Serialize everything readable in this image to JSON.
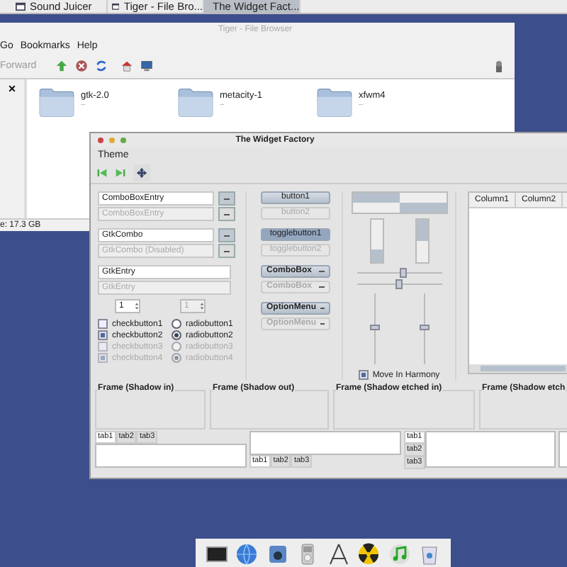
{
  "taskbar": {
    "tasks": [
      {
        "label": "Sound Juicer",
        "selected": false
      },
      {
        "label": "Tiger - File Bro...",
        "selected": false
      },
      {
        "label": "The Widget Fact...",
        "selected": true
      }
    ]
  },
  "file_browser": {
    "title": "Tiger - File Browser",
    "menu": [
      "Go",
      "Bookmarks",
      "Help"
    ],
    "forward_label": "Forward",
    "folders": [
      {
        "name": "gtk-2.0",
        "info": "--"
      },
      {
        "name": "metacity-1",
        "info": "--"
      },
      {
        "name": "xfwm4",
        "info": "--"
      }
    ],
    "status": "e: 17.3 GB"
  },
  "widget_factory": {
    "title": "The Widget Factory",
    "menu": [
      "Theme"
    ],
    "combos": [
      {
        "value": "ComboBoxEntry",
        "disabled": false
      },
      {
        "value": "ComboBoxEntry",
        "disabled": true
      },
      {
        "value": "GtkCombo",
        "disabled": false
      },
      {
        "value": "GtkCombo (Disabled)",
        "disabled": true
      }
    ],
    "entries": [
      {
        "value": "GtkEntry",
        "disabled": false
      },
      {
        "value": "GtkEntry",
        "disabled": true
      }
    ],
    "spin_buttons": [
      {
        "value": "1",
        "disabled": false
      },
      {
        "value": "1",
        "disabled": true
      }
    ],
    "checkbuttons": [
      {
        "label": "checkbutton1",
        "checked": false,
        "disabled": false
      },
      {
        "label": "checkbutton2",
        "checked": true,
        "disabled": false
      },
      {
        "label": "checkbutton3",
        "checked": false,
        "disabled": true
      },
      {
        "label": "checkbutton4",
        "checked": true,
        "disabled": true
      }
    ],
    "radiobuttons": [
      {
        "label": "radiobutton1",
        "selected": false,
        "disabled": false
      },
      {
        "label": "radiobutton2",
        "selected": true,
        "disabled": false
      },
      {
        "label": "radiobutton3",
        "selected": false,
        "disabled": true
      },
      {
        "label": "radiobutton4",
        "selected": true,
        "disabled": true
      }
    ],
    "buttons": [
      {
        "kind": "button",
        "label": "button1",
        "disabled": false
      },
      {
        "kind": "button",
        "label": "button2",
        "disabled": true
      },
      {
        "kind": "toggle",
        "label": "togglebutton1",
        "disabled": false,
        "pressed": true
      },
      {
        "kind": "toggle",
        "label": "togglebutton2",
        "disabled": true,
        "pressed": false
      },
      {
        "kind": "combo",
        "label": "ComboBox",
        "disabled": false
      },
      {
        "kind": "combo",
        "label": "ComboBox",
        "disabled": true
      },
      {
        "kind": "combo",
        "label": "OptionMenu",
        "disabled": false
      },
      {
        "kind": "combo",
        "label": "OptionMenu",
        "disabled": true
      }
    ],
    "progress_bars": [
      {
        "kind": "horizontal",
        "inverted": false,
        "level": 0.5
      },
      {
        "kind": "horizontal",
        "inverted": true,
        "level": 0.5
      },
      {
        "kind": "vertical",
        "inverted": false,
        "level": 0.3
      },
      {
        "kind": "vertical",
        "inverted": true,
        "level": 0.5
      }
    ],
    "scales": [
      {
        "kind": "horizontal",
        "level": 0.55
      },
      {
        "kind": "horizontal",
        "level": 0.5
      },
      {
        "kind": "vertical",
        "level": 0.5
      },
      {
        "kind": "vertical",
        "level": 0.5
      }
    ],
    "move_in_harmony": {
      "label": "Move In Harmony",
      "checked": true
    },
    "tree": {
      "columns": [
        "Column1",
        "Column2"
      ]
    },
    "frames": [
      "Frame (Shadow in)",
      "Frame (Shadow out)",
      "Frame (Shadow etched in)",
      "Frame (Shadow etch"
    ],
    "notebooks": [
      {
        "kind": "top",
        "tabs": [
          {
            "label": "tab1",
            "selected": true
          },
          {
            "label": "tab2",
            "selected": false
          },
          {
            "label": "tab3",
            "selected": false
          }
        ]
      },
      {
        "kind": "bottom",
        "tabs": [
          {
            "label": "tab1",
            "selected": true
          },
          {
            "label": "tab2",
            "selected": false
          },
          {
            "label": "tab3",
            "selected": false
          }
        ]
      },
      {
        "kind": "left",
        "tabs": [
          {
            "label": "tab1",
            "selected": true
          },
          {
            "label": "tab2",
            "selected": false
          },
          {
            "label": "tab3",
            "selected": false
          }
        ]
      },
      {
        "kind": "right"
      }
    ]
  }
}
